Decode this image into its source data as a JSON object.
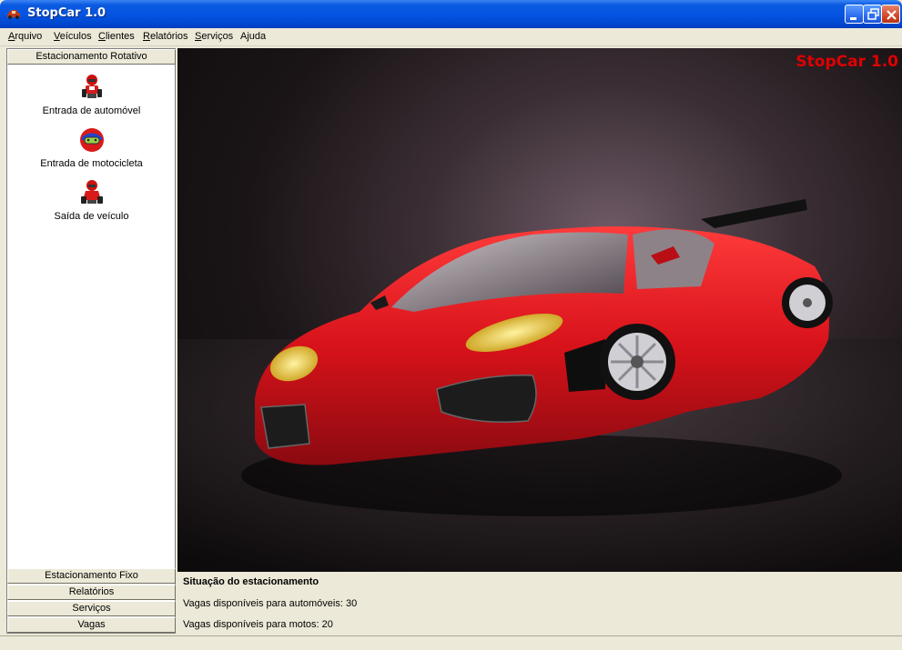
{
  "window": {
    "title": "StopCar 1.0"
  },
  "menu": [
    {
      "pre": "",
      "u": "A",
      "post": "rquivo"
    },
    {
      "pre": "",
      "u": "V",
      "post": "eículos"
    },
    {
      "pre": "",
      "u": "C",
      "post": "lientes"
    },
    {
      "pre": "",
      "u": "R",
      "post": "elatórios"
    },
    {
      "pre": "",
      "u": "S",
      "post": "erviços"
    },
    {
      "pre": "A",
      "u": "j",
      "post": "uda"
    }
  ],
  "sidebar": {
    "active_section": "Estacionamento Rotativo",
    "actions": [
      {
        "label": "Entrada de automóvel",
        "icon": "race-car-icon"
      },
      {
        "label": "Entrada de motocicleta",
        "icon": "helmet-icon"
      },
      {
        "label": "Saída de veículo",
        "icon": "race-car-exit-icon"
      }
    ],
    "sections": [
      "Estacionamento Fixo",
      "Relatórios",
      "Serviços",
      "Vagas"
    ]
  },
  "main": {
    "brand": "StopCar 1.0",
    "image": "red-sports-car"
  },
  "status": {
    "title": "Situação do estacionamento",
    "cars_line": "Vagas disponíveis para automóveis: 30",
    "motos_line": "Vagas disponíveis para motos: 20"
  },
  "colors": {
    "titlebar": "#0555e3",
    "brand": "#e00000",
    "car": "#d6101a"
  }
}
